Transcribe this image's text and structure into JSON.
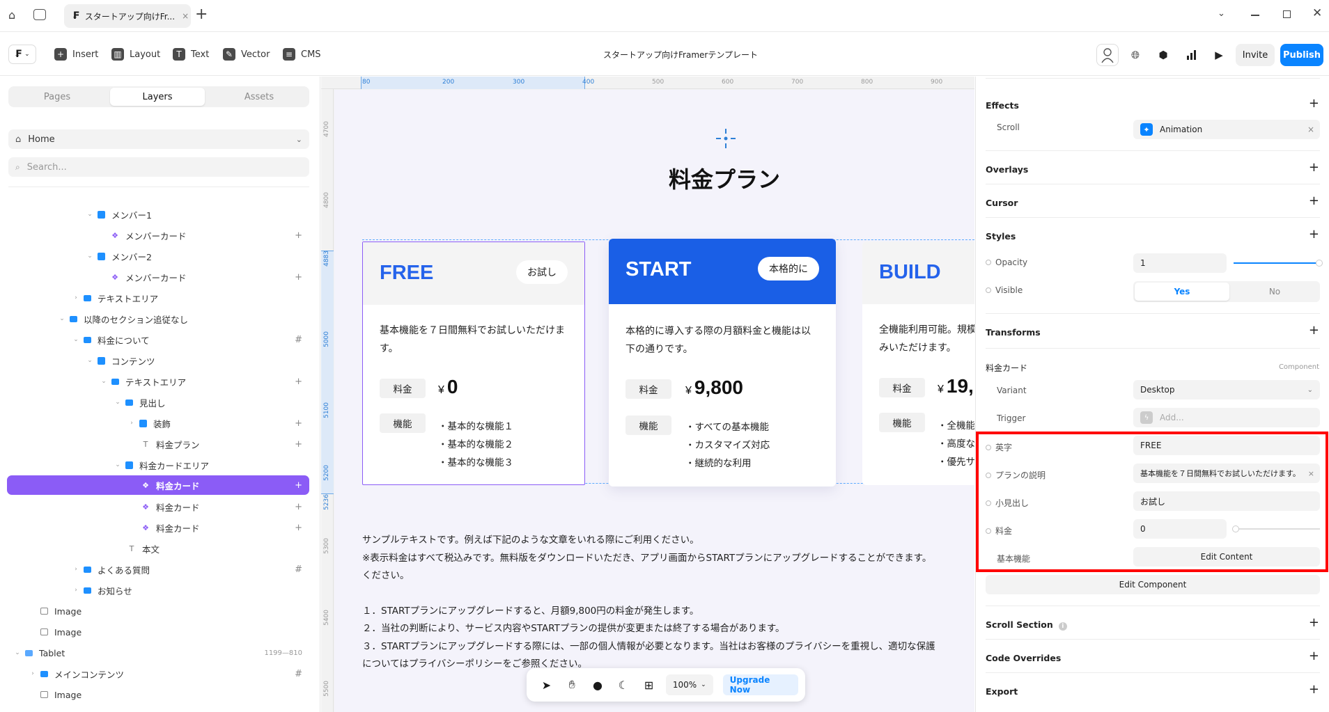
{
  "browser": {
    "tab_title": "スタートアップ向けFr...",
    "close": "×",
    "new_tab": "+"
  },
  "toolbar": {
    "insert": "Insert",
    "layout": "Layout",
    "text": "Text",
    "vector": "Vector",
    "cms": "CMS",
    "doc_title": "スタートアップ向けFramerテンプレート",
    "invite": "Invite",
    "publish": "Publish",
    "accent": "#0a84ff"
  },
  "left": {
    "tabs": {
      "pages": "Pages",
      "layers": "Layers",
      "assets": "Assets"
    },
    "page_select": "Home",
    "search_placeholder": "Search...",
    "layers": [
      {
        "label": "メンバー1"
      },
      {
        "label": "メンバーカード"
      },
      {
        "label": "メンバー2"
      },
      {
        "label": "メンバーカード"
      },
      {
        "label": "テキストエリア"
      },
      {
        "label": "以降のセクション追従なし"
      },
      {
        "label": "料金について"
      },
      {
        "label": "コンテンツ"
      },
      {
        "label": "テキストエリア"
      },
      {
        "label": "見出し"
      },
      {
        "label": "装飾"
      },
      {
        "label": "料金プラン"
      },
      {
        "label": "料金カードエリア"
      },
      {
        "label": "料金カード"
      },
      {
        "label": "料金カード"
      },
      {
        "label": "料金カード"
      },
      {
        "label": "本文"
      },
      {
        "label": "よくある質問"
      },
      {
        "label": "お知らせ"
      },
      {
        "label": "Image"
      },
      {
        "label": "Image"
      },
      {
        "label": "Tablet"
      },
      {
        "label": "メインコンテンツ"
      },
      {
        "label": "Image"
      }
    ],
    "tablet_size": "1199—810",
    "selected_color": "#8b5cf6"
  },
  "canvas": {
    "ruler_top": [
      "80",
      "200",
      "300",
      "400",
      "500",
      "600",
      "700",
      "800",
      "900"
    ],
    "ruler_left": [
      "4700",
      "4800",
      "4883",
      "5000",
      "5100",
      "5200",
      "5236",
      "5300",
      "5400",
      "5500"
    ],
    "heading": "料金プラン",
    "cards": [
      {
        "plan": "FREE",
        "pill": "お試し",
        "desc": "基本機能を７日間無料でお試しいただけます。",
        "price_label": "料金",
        "currency": "¥",
        "price": "0",
        "feature_label": "機能",
        "features": [
          "・基本的な機能１",
          "・基本的な機能２",
          "・基本的な機能３"
        ]
      },
      {
        "plan": "START",
        "pill": "本格的に",
        "desc": "本格的に導入する際の月額料金と機能は以下の通りです。",
        "price_label": "料金",
        "currency": "¥",
        "price": "9,800",
        "feature_label": "機能",
        "features": [
          "・すべての基本機能",
          "・カスタマイズ対応",
          "・継続的な利用"
        ]
      },
      {
        "plan": "BUILD",
        "pill": "",
        "desc": "全機能利用可能。規模みいただけます。",
        "price_label": "料金",
        "currency": "¥",
        "price": "19,",
        "feature_label": "機能",
        "features": [
          "・全機能",
          "・高度な",
          "・優先サ"
        ]
      }
    ],
    "body_text": [
      "サンプルテキストです。例えば下記のような文章をいれる際にご利用ください。",
      "※表示料金はすべて税込みです。無料版をダウンロードいただき、アプリ画面からSTARTプランにアップグレードすることができます。",
      "ください。",
      "",
      "１．STARTプランにアップグレードすると、月額9,800円の料金が発生します。",
      "２．当社の判断により、サービス内容やSTARTプランの提供が変更または終了する場合があります。",
      "３．STARTプランにアップグレードする際には、一部の個人情報が必要となります。当社はお客様のプライバシーを重視し、適切な保護",
      "についてはプライバシーポリシーをご参照ください。"
    ],
    "zoom": "100%",
    "upgrade": "Upgrade Now",
    "start_blue": "#1a5fe6"
  },
  "right": {
    "effects": "Effects",
    "scroll": "Scroll",
    "animation": "Animation",
    "overlays": "Overlays",
    "cursor": "Cursor",
    "styles": "Styles",
    "opacity": "Opacity",
    "opacity_value": "1",
    "visible": "Visible",
    "yes": "Yes",
    "no": "No",
    "transforms": "Transforms",
    "component_name": "料金カード",
    "component_tag": "Component",
    "variant": "Variant",
    "variant_value": "Desktop",
    "trigger": "Trigger",
    "trigger_placeholder": "Add...",
    "props": [
      {
        "label": "英字",
        "value": "FREE"
      },
      {
        "label": "プランの説明",
        "value": "基本機能を７日間無料でお試しいただけます。"
      },
      {
        "label": "小見出し",
        "value": "お試し"
      },
      {
        "label": "料金",
        "value": "0"
      },
      {
        "label": "基本機能",
        "value": "Edit Content"
      }
    ],
    "edit_component": "Edit Component",
    "scroll_section": "Scroll Section",
    "code_overrides": "Code Overrides",
    "export": "Export",
    "highlight": "#ff0000"
  }
}
